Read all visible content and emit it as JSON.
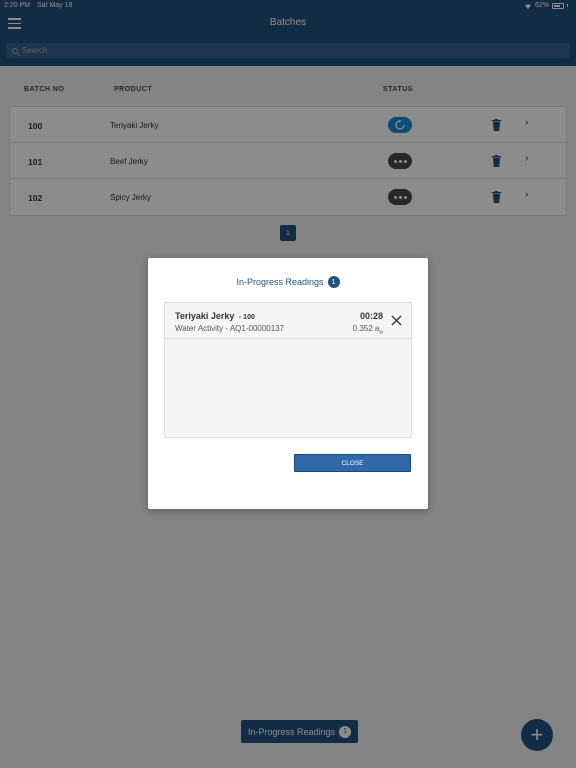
{
  "status_bar": {
    "time": "2:20 PM",
    "date": "Sat May 18",
    "battery": "62%"
  },
  "header": {
    "title": "Batches",
    "menu_icon": "hamburger-icon"
  },
  "search": {
    "placeholder": "Search",
    "icon": "search-icon"
  },
  "table": {
    "columns": [
      "BATCH NO",
      "PRODUCT",
      "STATUS"
    ],
    "rows": [
      {
        "batch_no": "100",
        "product": "Teriyaki Jerky",
        "status": "in-progress"
      },
      {
        "batch_no": "101",
        "product": "Beef Jerky",
        "status": "pending"
      },
      {
        "batch_no": "102",
        "product": "Spicy Jerky",
        "status": "pending"
      }
    ]
  },
  "pagination": {
    "current_page": "1"
  },
  "modal": {
    "title": "In-Progress Readings",
    "count": "1",
    "reading": {
      "product": "Teriyaki Jerky",
      "batch": "- 100",
      "detail": "Water Activity - AQ1-00000137",
      "elapsed": "00:28",
      "value": "0.352",
      "unit": "a",
      "unit_sub": "w"
    },
    "close_label": "CLOSE"
  },
  "bottom_bar": {
    "readings_label": "In-Progress Readings",
    "readings_count": "1",
    "add_label": "+"
  },
  "colors": {
    "header": "#245180",
    "accent": "#1a8fd8",
    "pending": "#4a4a4a"
  }
}
